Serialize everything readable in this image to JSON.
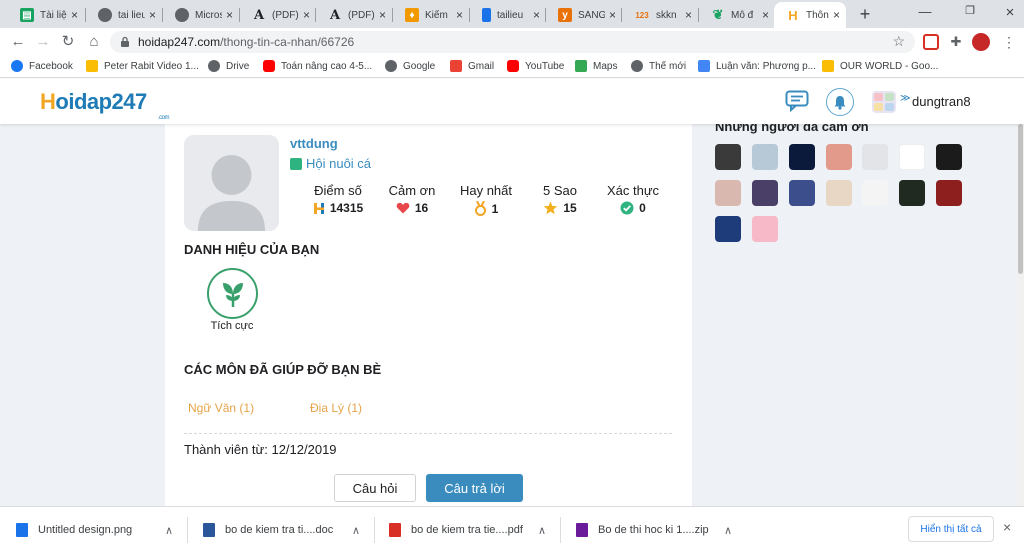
{
  "browser": {
    "tabs": [
      {
        "label": "Tài liệu",
        "icon": "docs-icon",
        "color": "#1aa260"
      },
      {
        "label": "tai lieu",
        "icon": "globe-icon",
        "color": "#5f6368"
      },
      {
        "label": "Micros",
        "icon": "globe-icon",
        "color": "#5f6368"
      },
      {
        "label": "(PDF)",
        "icon": "academia-icon",
        "color": "#202124"
      },
      {
        "label": "(PDF)",
        "icon": "academia-icon",
        "color": "#202124"
      },
      {
        "label": "Kiểm",
        "icon": "kiem-icon",
        "color": "#f29900"
      },
      {
        "label": "tailieu",
        "icon": "phone-icon",
        "color": "#1a73e8"
      },
      {
        "label": "SÁNG",
        "icon": "sang-icon",
        "color": "#e8710a"
      },
      {
        "label": "skkn",
        "icon": "123-icon",
        "color": "#e8710a"
      },
      {
        "label": "Mô đ",
        "icon": "leaf-icon",
        "color": "#1aa260"
      },
      {
        "label": "Thông",
        "icon": "hoidap-icon",
        "color": "#f2a623"
      }
    ],
    "new_tab": "+",
    "url_host": "hoidap247.com",
    "url_path": "/thong-tin-ca-nhan/66726",
    "bookmarks": [
      {
        "label": "Facebook",
        "color": "#1877f2"
      },
      {
        "label": "Peter Rabit Video 1...",
        "color": "#fbbc04"
      },
      {
        "label": "Drive",
        "color": "#5f6368"
      },
      {
        "label": "Toán nâng cao 4-5...",
        "color": "#ff0000"
      },
      {
        "label": "Google",
        "color": "#5f6368"
      },
      {
        "label": "Gmail",
        "color": "#ea4335"
      },
      {
        "label": "YouTube",
        "color": "#ff0000"
      },
      {
        "label": "Maps",
        "color": "#34a853"
      },
      {
        "label": "Thế mới",
        "color": "#5f6368"
      },
      {
        "label": "Luận văn: Phương p...",
        "color": "#4285f4"
      },
      {
        "label": "OUR WORLD - Goo...",
        "color": "#fbbc04"
      }
    ]
  },
  "site": {
    "logo_h": "H",
    "logo_rest": "oidap247",
    "logo_com": ".com",
    "username": "dungtran8"
  },
  "profile": {
    "nickname": "vttdung",
    "group": "Hội nuôi cá",
    "stats": [
      {
        "label": "Điểm số",
        "value": "14315",
        "icon": "hoidap-h-icon",
        "color": "#f2a623"
      },
      {
        "label": "Cảm ơn",
        "value": "16",
        "icon": "heart-icon",
        "color": "#e8474c"
      },
      {
        "label": "Hay nhất",
        "value": "1",
        "icon": "medal-icon",
        "color": "#f2a623"
      },
      {
        "label": "5 Sao",
        "value": "15",
        "icon": "star-icon",
        "color": "#f2b01e"
      },
      {
        "label": "Xác thực",
        "value": "0",
        "icon": "verified-icon",
        "color": "#2fb381"
      }
    ],
    "titles_heading": "DANH HIỆU CỦA BẠN",
    "badge_label": "Tích cực",
    "subjects_heading": "CÁC MÔN ĐÃ GIÚP ĐỠ BẠN BÈ",
    "subjects": [
      "Ngữ Văn (1)",
      "Địa Lý (1)"
    ],
    "member_since": "Thành viên từ: 12/12/2019",
    "btn_questions": "Câu hỏi",
    "btn_answers": "Câu trả lời"
  },
  "sidebar": {
    "thanks_title": "Những người đã cảm ơn"
  },
  "downloads": {
    "items": [
      {
        "name": "Untitled design.png",
        "color": "#1a73e8"
      },
      {
        "name": "bo de kiem tra ti....doc",
        "color": "#2b579a"
      },
      {
        "name": "bo de kiem tra tie....pdf",
        "color": "#d93025"
      },
      {
        "name": "Bo de thi hoc ki 1....zip",
        "color": "#6a1b9a"
      }
    ],
    "show_all": "Hiển thị tất cả"
  }
}
